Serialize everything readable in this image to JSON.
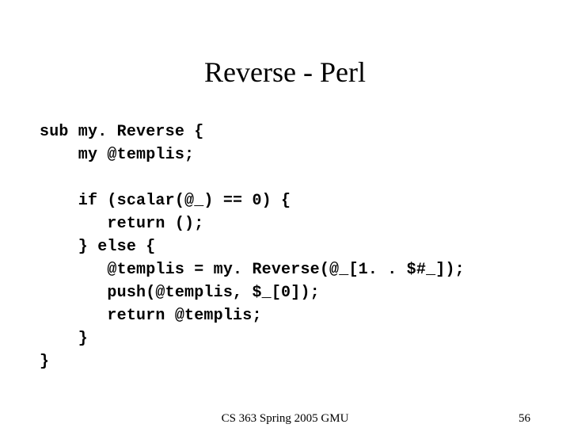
{
  "title": "Reverse - Perl",
  "code": {
    "l1": "sub my. Reverse {",
    "l2": "    my @templis;",
    "l3": "",
    "l4": "    if (scalar(@_) == 0) {",
    "l5": "       return ();",
    "l6": "    } else {",
    "l7": "       @templis = my. Reverse(@_[1. . $#_]);",
    "l8": "       push(@templis, $_[0]);",
    "l9": "       return @templis;",
    "l10": "    }",
    "l11": "}"
  },
  "footer": {
    "center": "CS 363 Spring 2005 GMU",
    "page": "56"
  }
}
